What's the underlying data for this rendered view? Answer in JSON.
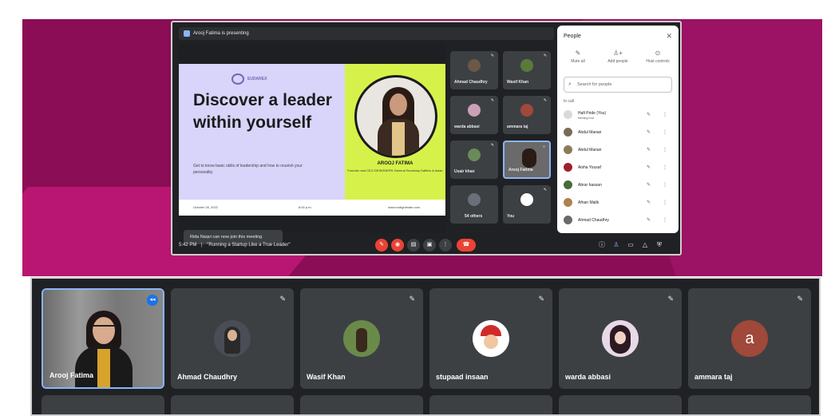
{
  "presenting_banner": "Arooj Fatima is presenting",
  "slide": {
    "logo_text": "EUDAREX",
    "title": "Discover a leader within yourself",
    "subtitle": "Get to know basic skills of leadership and how to nourish your personality.",
    "presenter_name": "AROOJ FATIMA",
    "presenter_role": "Founder and CEO DESIGNERS General Secretary Daffers & Asian",
    "footer_date": "October 26, 2022",
    "footer_time": "8:00 p.m.",
    "footer_url": "www.eudightmale.com"
  },
  "toast": "Rida Naqvi can now join this meeting",
  "tiles": [
    {
      "name": "Ahmad Chaudhry"
    },
    {
      "name": "Wasif Khan"
    },
    {
      "name": "warda abbasi"
    },
    {
      "name": "ammara taj"
    },
    {
      "name": "Usair khan"
    },
    {
      "name": "Arooj Fatima"
    },
    {
      "name": "54 others"
    },
    {
      "name": "You"
    }
  ],
  "bottom_bar": {
    "time": "5:42 PM",
    "separator": "|",
    "meeting_title": "\"Running a Startup Like a True Leader\""
  },
  "people_panel": {
    "title": "People",
    "actions": [
      {
        "label": "Mute all",
        "icon": "mic-off-icon"
      },
      {
        "label": "Add people",
        "icon": "add-person-icon"
      },
      {
        "label": "Host controls",
        "icon": "toggle-icon"
      }
    ],
    "search_placeholder": "Search for people",
    "section": "In call",
    "people": [
      {
        "name": "Hafi Pride (You)",
        "sub": "Meeting host"
      },
      {
        "name": "Abdul Manan",
        "sub": ""
      },
      {
        "name": "Abdul Manan",
        "sub": ""
      },
      {
        "name": "Aisha Yousaf",
        "sub": ""
      },
      {
        "name": "Abrar hassan",
        "sub": ""
      },
      {
        "name": "Afnan Malik",
        "sub": ""
      },
      {
        "name": "Ahmad Chaudhry",
        "sub": ""
      }
    ]
  },
  "gallery": [
    {
      "name": "Arooj Fatima"
    },
    {
      "name": "Ahmad Chaudhry"
    },
    {
      "name": "Wasif Khan"
    },
    {
      "name": "stupaad insaan"
    },
    {
      "name": "warda abbasi"
    },
    {
      "name": "ammara taj",
      "letter": "a"
    }
  ],
  "colors": {
    "background_magenta": "#8a0d55",
    "meet_dark": "#202124",
    "tile": "#3c4043",
    "end_call_red": "#ea4335",
    "slide_lavender": "#d8d4fa",
    "slide_lime": "#d6f24a",
    "active_blue": "#8ab4f8"
  }
}
